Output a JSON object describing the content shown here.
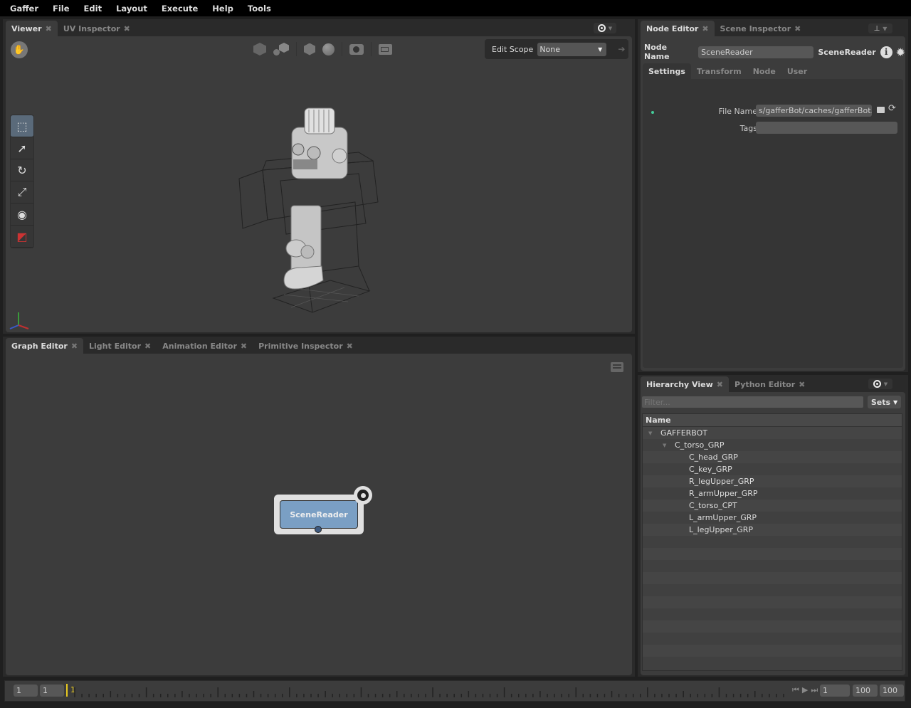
{
  "menu": [
    "Gaffer",
    "File",
    "Edit",
    "Layout",
    "Execute",
    "Help",
    "Tools"
  ],
  "viewer_panel": {
    "tabs": [
      {
        "label": "Viewer",
        "active": true
      },
      {
        "label": "UV Inspector",
        "active": false
      }
    ],
    "edit_scope_label": "Edit Scope",
    "edit_scope_value": "None",
    "toolbar_icons": [
      "selection-mask-icon",
      "shading-mode-icon",
      "expansion-icon",
      "sphere-icon",
      "camera-icon",
      "grid-gnomon-icon"
    ],
    "tools": [
      "selection-tool-icon",
      "translate-tool-icon",
      "rotate-tool-icon",
      "scale-tool-icon",
      "camera-tool-icon",
      "crop-window-tool-icon"
    ]
  },
  "graph_panel": {
    "tabs": [
      {
        "label": "Graph Editor",
        "active": true
      },
      {
        "label": "Light Editor",
        "active": false
      },
      {
        "label": "Animation Editor",
        "active": false
      },
      {
        "label": "Primitive Inspector",
        "active": false
      }
    ],
    "node": {
      "label": "SceneReader",
      "color": "#7a9fc4"
    }
  },
  "node_editor": {
    "tabs": [
      {
        "label": "Node Editor",
        "active": true
      },
      {
        "label": "Scene Inspector",
        "active": false
      }
    ],
    "node_name_label": "Node Name",
    "node_name_value": "SceneReader",
    "node_type": "SceneReader",
    "section_tabs": [
      {
        "label": "Settings",
        "active": true
      },
      {
        "label": "Transform",
        "active": false
      },
      {
        "label": "Node",
        "active": false
      },
      {
        "label": "User",
        "active": false
      }
    ],
    "file_name_label": "File Name",
    "file_name_value": "s/gafferBot/caches/gafferBot.scc",
    "tags_label": "Tags",
    "tags_value": ""
  },
  "hierarchy": {
    "tabs": [
      {
        "label": "Hierarchy View",
        "active": true
      },
      {
        "label": "Python Editor",
        "active": false
      }
    ],
    "filter_placeholder": "Filter...",
    "sets_label": "Sets",
    "column_header": "Name",
    "rows": [
      {
        "label": "GAFFERBOT",
        "depth": 0,
        "expanded": true
      },
      {
        "label": "C_torso_GRP",
        "depth": 1,
        "expanded": true
      },
      {
        "label": "C_head_GRP",
        "depth": 2
      },
      {
        "label": "C_key_GRP",
        "depth": 2
      },
      {
        "label": "R_legUpper_GRP",
        "depth": 2
      },
      {
        "label": "R_armUpper_GRP",
        "depth": 2
      },
      {
        "label": "C_torso_CPT",
        "depth": 2
      },
      {
        "label": "L_armUpper_GRP",
        "depth": 2
      },
      {
        "label": "L_legUpper_GRP",
        "depth": 2
      }
    ]
  },
  "timeline": {
    "start_range": "1",
    "start": "1",
    "current_frame": "1",
    "frame_field": "1",
    "end": "100",
    "end_range": "100"
  }
}
